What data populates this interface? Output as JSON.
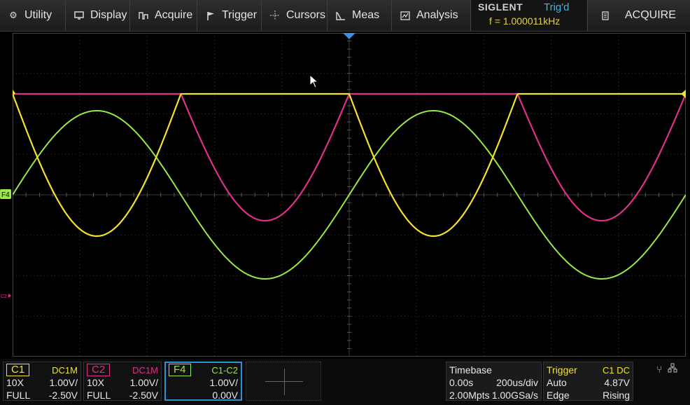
{
  "menu": {
    "items": [
      {
        "label": "Utility",
        "icon": "gear-icon"
      },
      {
        "label": "Display",
        "icon": "monitor-icon"
      },
      {
        "label": "Acquire",
        "icon": "acquire-icon"
      },
      {
        "label": "Trigger",
        "icon": "flag-icon"
      },
      {
        "label": "Cursors",
        "icon": "crosshair-icon"
      },
      {
        "label": "Meas",
        "icon": "measure-icon"
      },
      {
        "label": "Analysis",
        "icon": "analysis-icon"
      }
    ],
    "brand": "SIGLENT",
    "trig_status": "Trig'd",
    "frequency": "f = 1.000011kHz",
    "acquire_label": "ACQUIRE"
  },
  "markers": {
    "f4": "F4",
    "c2": "C2"
  },
  "channels": {
    "c1": {
      "name": "C1",
      "coupling": "DC1M",
      "probe": "10X",
      "scale": "1.00V/",
      "bw": "FULL",
      "offset": "-2.50V",
      "color": "#f2e22e"
    },
    "c2": {
      "name": "C2",
      "coupling": "DC1M",
      "probe": "10X",
      "scale": "1.00V/",
      "bw": "FULL",
      "offset": "-2.50V",
      "color": "#e0308a"
    },
    "f4": {
      "name": "F4",
      "source": "C1-C2",
      "scale": "1.00V/",
      "offset": "0.00V",
      "color": "#9be64a"
    }
  },
  "timebase": {
    "title": "Timebase",
    "delay": "0.00s",
    "scale": "200us/div",
    "memory": "2.00Mpts",
    "sample_rate": "1.00GSa/s"
  },
  "trigger": {
    "title": "Trigger",
    "source": "C1 DC",
    "mode": "Auto",
    "level": "4.87V",
    "type": "Edge",
    "slope": "Rising"
  },
  "waveform_params": {
    "period_divisions": 5,
    "c1_clip_level_div": -1,
    "c1_phase": "half-wave inverted",
    "f4_amplitude_div": 2.6
  }
}
